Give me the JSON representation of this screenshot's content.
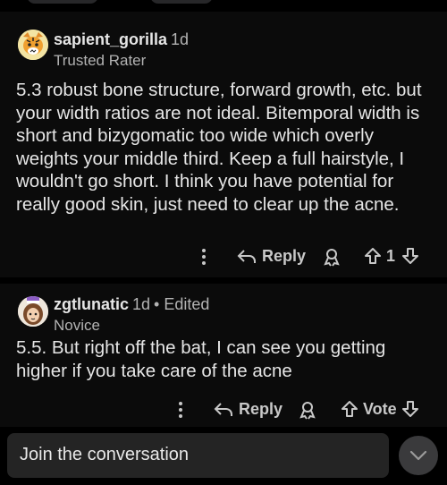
{
  "comments": [
    {
      "username": "sapient_gorilla",
      "age": "1d",
      "flair": "Trusted Rater",
      "body": "5.3 robust bone structure, forward growth, etc. but your width ratios are not ideal. Bitemporal width is short and bizygomatic too wide which overly weights your middle third. Keep a full hairstyle, I wouldn't go short. I think you have potential for really good skin, just need to clear up the acne.",
      "reply_label": "Reply",
      "vote_label": "1"
    },
    {
      "username": "zgtlunatic",
      "age": "1d",
      "edited": "• Edited",
      "flair": "Novice",
      "body": "5.5. But right off the bat, I can see you getting higher if you take care of the acne",
      "reply_label": "Reply",
      "vote_label": "Vote"
    }
  ],
  "composer": {
    "placeholder": "Join the conversation"
  },
  "icons": {
    "more": "more-vertical-icon",
    "reply": "reply-arrow-icon",
    "award": "award-icon",
    "upvote": "upvote-arrow-icon",
    "downvote": "downvote-arrow-icon",
    "send": "chevron-down-icon"
  }
}
